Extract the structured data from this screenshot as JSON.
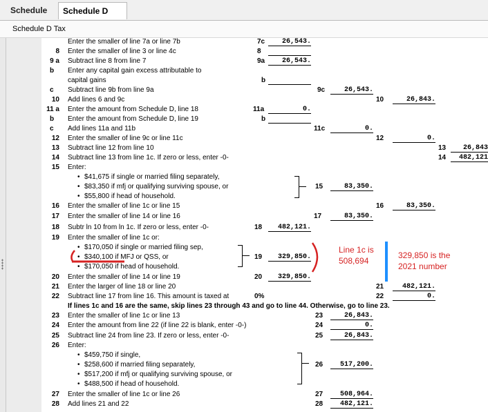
{
  "tabs": [
    {
      "label": "Schedule D",
      "active": false
    },
    {
      "label": "Schedule D Tax",
      "active": true
    }
  ],
  "breadcrumb": "Schedule D Tax",
  "lines": {
    "l7c": {
      "num": "c",
      "text": "Enter the smaller of line 7a or line 7b",
      "box": "7c",
      "value": "26,543."
    },
    "l8": {
      "num": "8",
      "text": "Enter the smaller of line 3 or line 4c",
      "box": "8",
      "value": ""
    },
    "l9a": {
      "num": "9 a",
      "text": "Subtract line 8 from line 7",
      "box": "9a",
      "value": "26,543."
    },
    "l9b": {
      "num": "b",
      "text": "Enter any capital gain excess attributable to",
      "text2": "capital gains",
      "box": "b",
      "value": ""
    },
    "l9c": {
      "num": "c",
      "text": "Subtract line 9b from line 9a",
      "box": "9c",
      "value": "26,543."
    },
    "l10": {
      "num": "10",
      "text": "Add lines 6 and 9c",
      "box": "10",
      "value": "26,843."
    },
    "l11a": {
      "num": "11 a",
      "text": "Enter the amount from Schedule D, line 18",
      "box": "11a",
      "value": "0."
    },
    "l11b": {
      "num": "b",
      "text": "Enter the amount from Schedule D, line 19",
      "box": "b",
      "value": ""
    },
    "l11c": {
      "num": "c",
      "text": "Add lines 11a and 11b",
      "box": "11c",
      "value": "0."
    },
    "l12": {
      "num": "12",
      "text": "Enter the smaller of line 9c or line 11c",
      "box": "12",
      "value": "0."
    },
    "l13": {
      "num": "13",
      "text": "Subtract line 12 from line 10",
      "box": "13",
      "value": "26,843"
    },
    "l14": {
      "num": "14",
      "text": "Subtract line 13 from line 1c. If zero or less, enter -0-",
      "box": "14",
      "value": "482,121"
    },
    "l15": {
      "num": "15",
      "text": "Enter:",
      "bullets": [
        "$41,675 if single or married filing separately,",
        "$83,350 if mfj or qualifying surviving spouse, or",
        "$55,800 if head of household."
      ],
      "box": "15",
      "value": "83,350."
    },
    "l16": {
      "num": "16",
      "text": "Enter the smaller of line 1c or line 15",
      "box": "16",
      "value": "83,350."
    },
    "l17": {
      "num": "17",
      "text": "Enter the smaller of line 14 or line 16",
      "box": "17",
      "value": "83,350."
    },
    "l18": {
      "num": "18",
      "text": "Subtr ln 10 from ln 1c. If zero or less, enter -0-",
      "box": "18",
      "value": "482,121."
    },
    "l19": {
      "num": "19",
      "text": "Enter the smaller of line 1c or:",
      "bullets": [
        "$170,050 if single or married filing sep,",
        "$340,100 if MFJ or QSS, or",
        "$170,050 if head of household."
      ],
      "box": "19",
      "value": "329,850."
    },
    "l20": {
      "num": "20",
      "text": "Enter the smaller of line 14 or line 19",
      "box": "20",
      "value": "329,850."
    },
    "l21": {
      "num": "21",
      "text": "Enter the larger of line 18 or line 20",
      "box": "21",
      "value": "482,121."
    },
    "l22": {
      "num": "22",
      "text": "Subtract line 17 from line 16. This amount is taxed at",
      "pct": "0%",
      "box": "22",
      "value": "0."
    },
    "note": "If lines 1c and 16 are the same, skip lines 23 through 43 and go to line 44. Otherwise, go to line 23.",
    "l23": {
      "num": "23",
      "text": "Enter the smaller of line 1c or line 13",
      "box": "23",
      "value": "26,843."
    },
    "l24": {
      "num": "24",
      "text": "Enter the amount from line 22 (if line 22 is blank, enter -0-)",
      "box": "24",
      "value": "0."
    },
    "l25": {
      "num": "25",
      "text": "Subtract line 24 from line 23. If zero or less, enter -0-",
      "box": "25",
      "value": "26,843."
    },
    "l26": {
      "num": "26",
      "text": "Enter:",
      "bullets": [
        "$459,750 if single,",
        "$258,600 if married filing separately,",
        "$517,200 if mfj or qualifying surviving spouse, or",
        "$488,500 if head of household."
      ],
      "box": "26",
      "value": "517,200."
    },
    "l27": {
      "num": "27",
      "text": "Enter the smaller of line 1c or line 26",
      "box": "27",
      "value": "508,964."
    },
    "l28": {
      "num": "28",
      "text": "Add lines 21 and 22",
      "box": "28",
      "value": "482,121."
    }
  },
  "annotations": {
    "note1": [
      "Line 1c is",
      "508,694"
    ],
    "note2": [
      "329,850 is the",
      "2021 number"
    ],
    "colors": {
      "red": "#d62222",
      "blue": "#1e90ff"
    }
  }
}
